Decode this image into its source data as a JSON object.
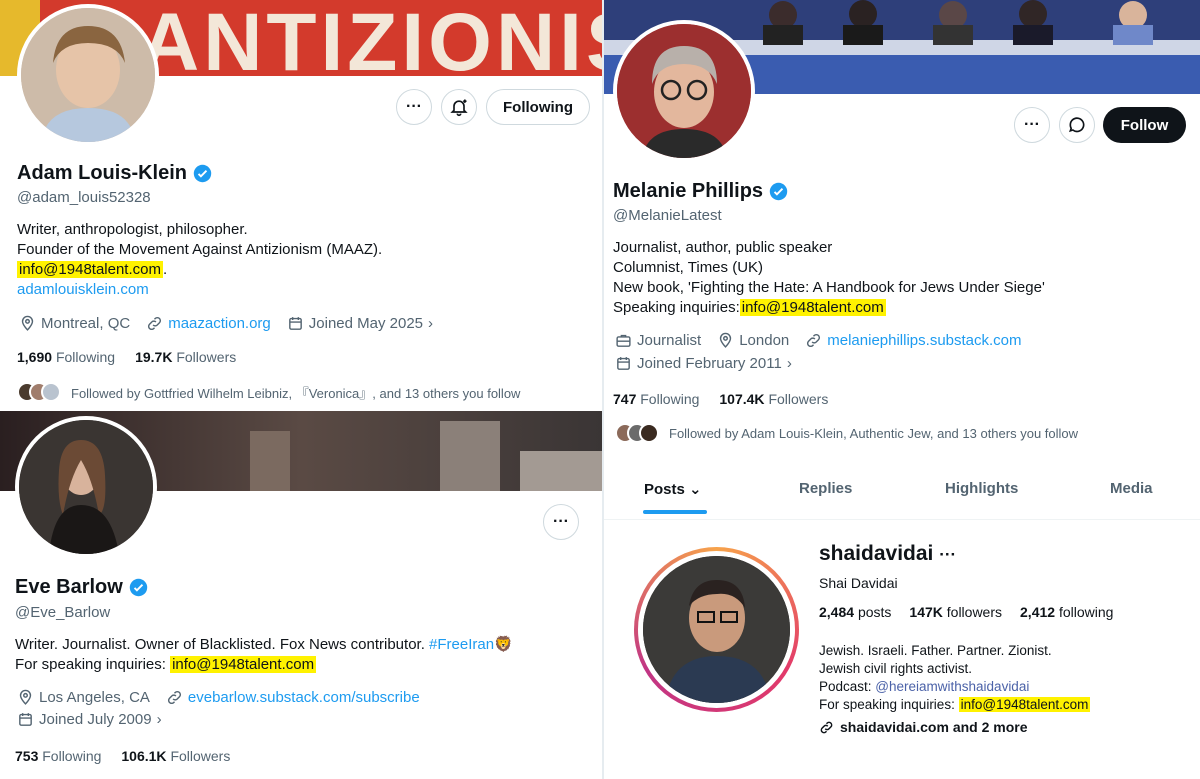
{
  "adam": {
    "banner_text": "ANTIZIONISM",
    "name": "Adam Louis-Klein",
    "handle": "@adam_louis52328",
    "bio_lines": [
      "Writer, anthropologist, philosopher.",
      "Founder of the Movement Against Antizionism (MAAZ)."
    ],
    "email": "info@1948talent.com",
    "email_suffix": ".",
    "website": "adamlouisklein.com",
    "location": "Montreal, QC",
    "url": "maazaction.org",
    "joined": "Joined May 2025",
    "following_count": "1,690",
    "following_label": "Following",
    "followers_count": "19.7K",
    "followers_label": "Followers",
    "followed_by": "Followed by Gottfried Wilhelm Leibniz, 『Veronica』, and 13 others you follow",
    "follow_button": "Following",
    "more_icon": "more-icon",
    "notify_icon": "bell-plus-icon"
  },
  "eve": {
    "name": "Eve Barlow",
    "handle": "@Eve_Barlow",
    "bio_line1": "Writer. Journalist. Owner of Blacklisted. Fox News contributor.",
    "hashtag": "#FreeIran",
    "emoji": "🦁",
    "bio_line2_prefix": "For speaking inquiries:",
    "email": "info@1948talent.com",
    "location": "Los Angeles, CA",
    "url": "evebarlow.substack.com/subscribe",
    "joined": "Joined July 2009",
    "following_count": "753",
    "following_label": "Following",
    "followers_count": "106.1K",
    "followers_label": "Followers"
  },
  "melanie": {
    "name": "Melanie Phillips",
    "handle": "@MelanieLatest",
    "bio_lines": [
      "Journalist, author, public speaker",
      "Columnist, Times (UK)",
      "New book, 'Fighting the Hate: A Handbook for Jews Under Siege'"
    ],
    "bio_line4_prefix": "Speaking inquiries:",
    "email": "info@1948talent.com",
    "category": "Journalist",
    "location": "London",
    "url": "melaniephillips.substack.com",
    "joined": "Joined February 2011",
    "following_count": "747",
    "following_label": "Following",
    "followers_count": "107.4K",
    "followers_label": "Followers",
    "followed_by": "Followed by Adam Louis-Klein, Authentic Jew, and 13 others you follow",
    "follow_button": "Follow",
    "tabs": [
      "Posts",
      "Replies",
      "Highlights",
      "Media"
    ]
  },
  "shai": {
    "username": "shaidavidai",
    "more": "···",
    "full_name": "Shai Davidai",
    "posts_count": "2,484",
    "posts_label": "posts",
    "followers_count": "147K",
    "followers_label": "followers",
    "following_count": "2,412",
    "following_label": "following",
    "bio_lines": [
      "Jewish. Israeli. Father. Partner. Zionist.",
      "Jewish civil rights activist."
    ],
    "podcast_prefix": "Podcast:",
    "podcast_handle": "@hereiamwithshaidavidai",
    "speaking_prefix": "For speaking inquiries:",
    "email": "info@1948talent.com",
    "link": "shaidavidai.com and 2 more"
  },
  "colors": {
    "highlight": "#fff200",
    "link": "#1d9bf0",
    "muted": "#536471",
    "verified": "#1d9bf0"
  }
}
